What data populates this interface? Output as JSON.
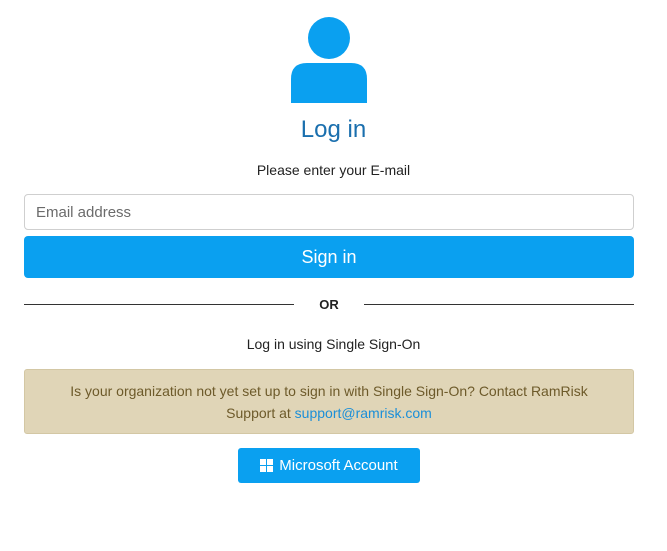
{
  "login": {
    "title": "Log in",
    "subtitle": "Please enter your E-mail",
    "email_placeholder": "Email address",
    "email_value": "",
    "signin_label": "Sign in"
  },
  "divider": {
    "label": "OR"
  },
  "sso": {
    "label": "Log in using Single Sign-On",
    "notice_text": "Is your organization not yet set up to sign in with Single Sign-On? Contact RamRisk Support at ",
    "notice_email": "support@ramrisk.com",
    "microsoft_label": "Microsoft Account"
  },
  "icons": {
    "avatar": "user-avatar-icon",
    "microsoft": "windows-logo-icon"
  },
  "colors": {
    "primary": "#0aa0f0",
    "title": "#1a6fae",
    "notice_bg": "#e0d5b7",
    "notice_text": "#6d5a2a",
    "link": "#1b8fd8"
  }
}
